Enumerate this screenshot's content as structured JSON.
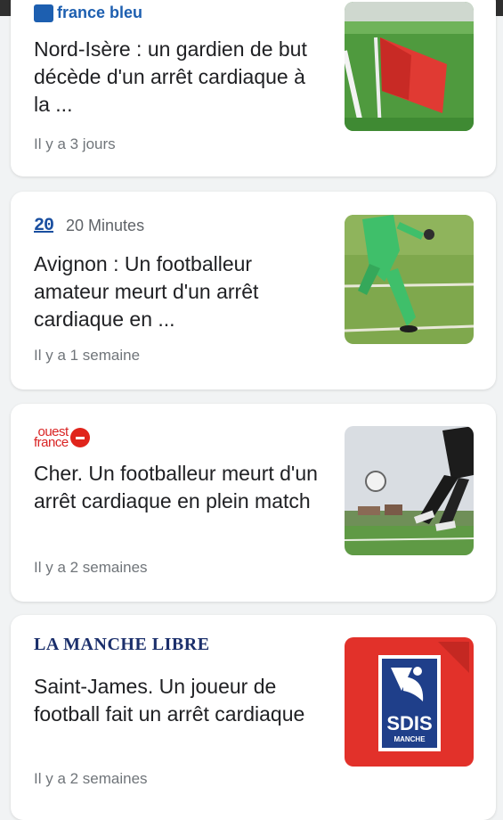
{
  "articles": [
    {
      "source": "france bleu",
      "source_logo": "france-bleu-logo",
      "headline": "Nord-Isère : un gardien de but décède d'un arrêt cardiaque à la ...",
      "time": "Il y a 3 jours",
      "thumbnail": "corner-flag-photo"
    },
    {
      "source_logo_text": "20",
      "source": "20 Minutes",
      "headline": "Avignon : Un footballeur amateur meurt d'un arrêt cardiaque en ...",
      "time": "Il y a 1 semaine",
      "thumbnail": "goalkeeper-kick-photo"
    },
    {
      "source_logo_text_top": "ouest",
      "source_logo_text_bottom": "france",
      "headline": "Cher. Un footballeur meurt d'un arrêt cardiaque en plein match",
      "time": "Il y a 2 semaines",
      "thumbnail": "football-kick-photo"
    },
    {
      "source": "LA MANCHE LIBRE",
      "headline": "Saint-James. Un joueur de football fait un arrêt cardiaque",
      "time": "Il y a 2 semaines",
      "thumbnail": "sdis-manche-logo",
      "thumbnail_text": "SDIS",
      "thumbnail_subtext": "MANCHE"
    }
  ],
  "colors": {
    "background": "#f1f3f4",
    "card": "#ffffff",
    "headline": "#202124",
    "meta": "#70757a",
    "france_bleu": "#1d5fb0",
    "ouest_france": "#e0241b",
    "la_manche_libre": "#1b2f6b",
    "sdis_red": "#e2312a"
  }
}
